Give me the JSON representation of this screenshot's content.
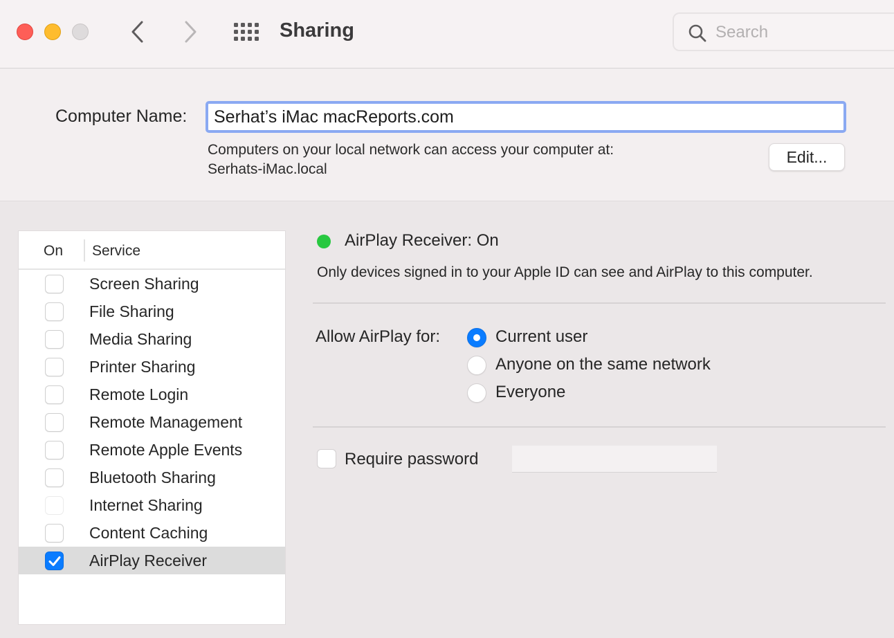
{
  "window": {
    "title": "Sharing",
    "search_placeholder": "Search",
    "search_value": ""
  },
  "computer_name": {
    "label": "Computer Name:",
    "value": "Serhat’s iMac macReports.com",
    "description_line1": "Computers on your local network can access your computer at:",
    "description_line2": "Serhats-iMac.local",
    "edit_button": "Edit..."
  },
  "services": {
    "header_on": "On",
    "header_service": "Service",
    "items": [
      {
        "label": "Screen Sharing",
        "checked": false,
        "enabled": true
      },
      {
        "label": "File Sharing",
        "checked": false,
        "enabled": true
      },
      {
        "label": "Media Sharing",
        "checked": false,
        "enabled": true
      },
      {
        "label": "Printer Sharing",
        "checked": false,
        "enabled": true
      },
      {
        "label": "Remote Login",
        "checked": false,
        "enabled": true
      },
      {
        "label": "Remote Management",
        "checked": false,
        "enabled": true
      },
      {
        "label": "Remote Apple Events",
        "checked": false,
        "enabled": true
      },
      {
        "label": "Bluetooth Sharing",
        "checked": false,
        "enabled": true
      },
      {
        "label": "Internet Sharing",
        "checked": false,
        "enabled": false
      },
      {
        "label": "Content Caching",
        "checked": false,
        "enabled": true
      },
      {
        "label": "AirPlay Receiver",
        "checked": true,
        "enabled": true,
        "selected": true
      }
    ]
  },
  "detail": {
    "status_text": "AirPlay Receiver: On",
    "status_color": "#28c840",
    "status_description": "Only devices signed in to your Apple ID can see and AirPlay to this computer.",
    "allow_label": "Allow AirPlay for:",
    "allow_options": [
      {
        "label": "Current user",
        "selected": true
      },
      {
        "label": "Anyone on the same network",
        "selected": false
      },
      {
        "label": "Everyone",
        "selected": false
      }
    ],
    "require_password_label": "Require password",
    "require_password_checked": false,
    "password_value": ""
  },
  "colors": {
    "accent": "#0a7cff",
    "focus_ring": "#8aa9f2",
    "close": "#fe5e57",
    "minimize": "#febc2e",
    "zoom_disabled": "#dedbdc"
  }
}
